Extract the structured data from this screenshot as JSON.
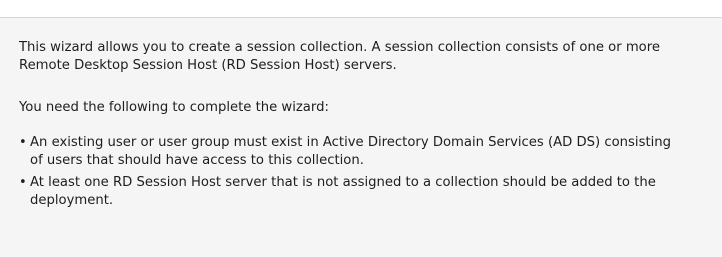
{
  "intro": {
    "line1": "This wizard allows you to create a session collection. A session collection consists of one or more",
    "line2": "Remote Desktop Session Host (RD Session Host) servers."
  },
  "requirements_heading": "You need the following to complete the wizard:",
  "requirements": [
    {
      "line1": "An existing user or user group must exist in Active Directory Domain Services (AD DS) consisting",
      "line2": "of users that should have access to this collection."
    },
    {
      "line1": "At least one RD Session Host server that is not assigned to a collection should be added to the",
      "line2": "deployment."
    }
  ],
  "bullet": "•"
}
